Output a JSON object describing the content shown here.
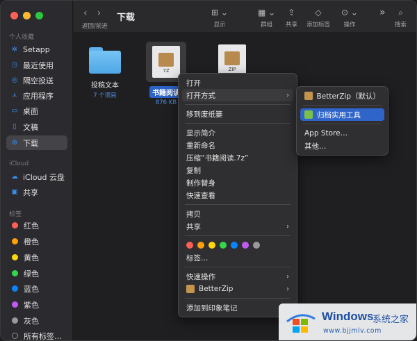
{
  "sidebar": {
    "favorites_title": "个人收藏",
    "favorites": [
      {
        "label": "Setapp",
        "icon": "setapp-icon"
      },
      {
        "label": "最近使用",
        "icon": "clock-icon"
      },
      {
        "label": "隔空投送",
        "icon": "airdrop-icon"
      },
      {
        "label": "应用程序",
        "icon": "applications-icon"
      },
      {
        "label": "桌面",
        "icon": "desktop-icon"
      },
      {
        "label": "文稿",
        "icon": "document-icon"
      },
      {
        "label": "下载",
        "icon": "download-icon",
        "active": true
      }
    ],
    "icloud_title": "iCloud",
    "icloud": [
      {
        "label": "iCloud 云盘",
        "icon": "cloud-icon"
      },
      {
        "label": "共享",
        "icon": "shared-folder-icon"
      }
    ],
    "tags_title": "标签",
    "tags": [
      {
        "label": "红色",
        "color": "#ff5f57"
      },
      {
        "label": "橙色",
        "color": "#ff9f0a"
      },
      {
        "label": "黄色",
        "color": "#ffd60a"
      },
      {
        "label": "绿色",
        "color": "#32d74b"
      },
      {
        "label": "蓝色",
        "color": "#0a84ff"
      },
      {
        "label": "紫色",
        "color": "#bf5af2"
      },
      {
        "label": "灰色",
        "color": "#98989d"
      },
      {
        "label": "所有标签…",
        "color": "#5a5a5e"
      }
    ]
  },
  "toolbar": {
    "back": "‹",
    "forward": "›",
    "nav_label": "返回/前进",
    "title": "下载",
    "view_label": "显示",
    "group_label": "群组",
    "share_label": "共享",
    "tag_label": "添加标签",
    "action_label": "操作",
    "more": "»",
    "search_label": "搜索"
  },
  "files": {
    "folder_name": "投稿文本",
    "folder_sub": "7 个项目",
    "selected_name": "书籍阅读",
    "selected_sub": "876 KB",
    "archive_ext": "7Z",
    "archive2_ext": "ZIP"
  },
  "context_menu": {
    "open": "打开",
    "open_with": "打开方式",
    "trash": "移到废纸篓",
    "get_info": "显示简介",
    "rename": "重新命名",
    "compress": "压缩“书籍阅读.7z”",
    "duplicate": "复制",
    "make_alias": "制作替身",
    "quick_look": "快速查看",
    "copy": "拷贝",
    "share": "共享",
    "tag_colors": [
      "#ff5f57",
      "#ff9f0a",
      "#ffd60a",
      "#32d74b",
      "#0a84ff",
      "#bf5af2",
      "#98989d"
    ],
    "tags": "标签…",
    "quick_actions": "快速操作",
    "betterzip": "BetterZip",
    "evernote": "添加到印象笔记"
  },
  "submenu": {
    "default_app": "BetterZip（默认）",
    "archive_utility": "归档实用工具",
    "app_store": "App Store…",
    "other": "其他…"
  },
  "watermark": {
    "brand": "Windows",
    "cn": "系统之家",
    "url": "www.bjjmlv.com"
  }
}
